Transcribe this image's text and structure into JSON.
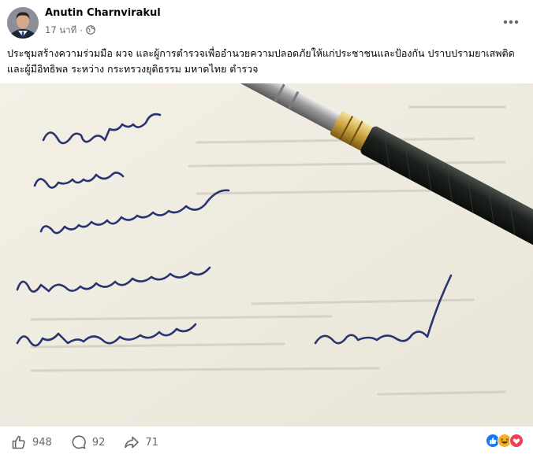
{
  "post": {
    "author": "Anutin Charnvirakul",
    "time": "17 นาที",
    "separator": "·",
    "caption": "ประชุมสร้างความร่วมมือ ผวจ และผู้การตำรวจเพื่ออำนวยความปลอดภัยให้แก่ประชาชนและป้องกัน ปราบปรามยาเสพติดและผู้มีอิทธิพล ระหว่าง กระทรวงยุติธรรม มหาดไทย ตำรวจ",
    "audience_icon": "globe-icon",
    "more_icon": "more-horizontal-icon"
  },
  "photo": {
    "handwriting": [
      "ปัญญาติทุกข์",
      "บำรุงสุข",
      "พิทักษ์สันติราษฎร์",
      "พิฆาตยาเสพติด",
      "พิชิตอันธพาล"
    ],
    "signature_date": "๑๗ พ.ค. ๖๗",
    "colors": {
      "ink": "#1f2a6b",
      "paper": "#f1eee4"
    }
  },
  "footer": {
    "likes": "948",
    "comments": "92",
    "shares": "71",
    "reaction_icons": [
      "like-reaction-icon",
      "haha-reaction-icon",
      "love-reaction-icon"
    ]
  },
  "colors": {
    "secondary_text": "#65676b",
    "like_blue": "#1877f2",
    "love_red": "#f33e58",
    "haha_yellow": "#f7b125"
  }
}
